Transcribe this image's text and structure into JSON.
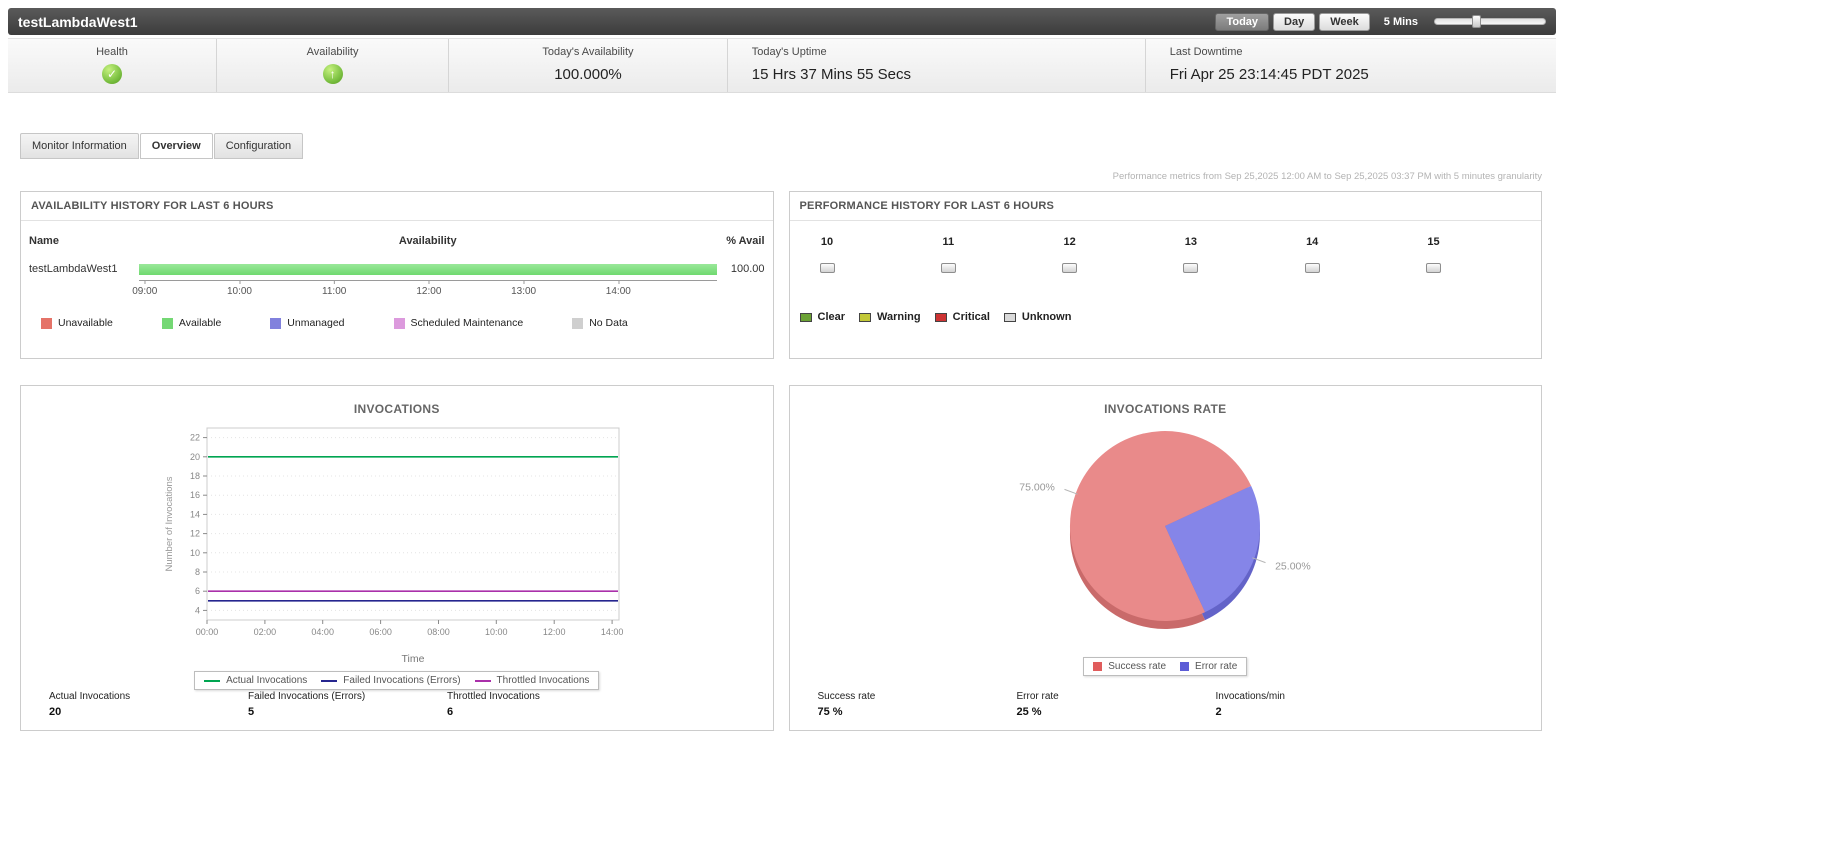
{
  "header": {
    "title": "testLambdaWest1",
    "period_buttons": [
      {
        "label": "Today",
        "active": true
      },
      {
        "label": "Day",
        "active": false
      },
      {
        "label": "Week",
        "active": false
      }
    ],
    "granularity_label": "5 Mins"
  },
  "status_bar": {
    "items": [
      {
        "label": "Health",
        "icon": "health-status-ok",
        "glyph": "✓"
      },
      {
        "label": "Availability",
        "icon": "availability-status-up",
        "glyph": "↑"
      },
      {
        "label": "Today's Availability",
        "value": "100.000%"
      },
      {
        "label": "Today's Uptime",
        "value": "15 Hrs 37 Mins 55 Secs"
      },
      {
        "label": "Last Downtime",
        "value": "Fri Apr 25 23:14:45 PDT 2025"
      }
    ]
  },
  "tabs": [
    {
      "label": "Monitor Information",
      "active": false
    },
    {
      "label": "Overview",
      "active": true
    },
    {
      "label": "Configuration",
      "active": false
    }
  ],
  "metrics_note": "Performance metrics from Sep 25,2025 12:00 AM to Sep 25,2025 03:37 PM with 5 minutes granularity",
  "availability_panel": {
    "title": "AVAILABILITY HISTORY FOR LAST 6 HOURS",
    "columns": {
      "name": "Name",
      "availability": "Availability",
      "avail_pct": "% Avail"
    },
    "row": {
      "name": "testLambdaWest1",
      "avail_pct": "100.00",
      "availability_percent": 100
    },
    "x_ticks": [
      "09:00",
      "10:00",
      "11:00",
      "12:00",
      "13:00",
      "14:00"
    ],
    "bar_color": "#6fd96f",
    "legend": [
      {
        "label": "Unavailable",
        "color": "#e57368"
      },
      {
        "label": "Available",
        "color": "#74d874"
      },
      {
        "label": "Unmanaged",
        "color": "#8181dd"
      },
      {
        "label": "Scheduled Maintenance",
        "color": "#dc9add"
      },
      {
        "label": "No Data",
        "color": "#cfcfcf"
      }
    ]
  },
  "performance_panel": {
    "title": "PERFORMANCE HISTORY FOR LAST 6 HOURS",
    "hours": [
      "10",
      "11",
      "12",
      "13",
      "14",
      "15"
    ],
    "legend": [
      {
        "label": "Clear",
        "color": "#6ba235"
      },
      {
        "label": "Warning",
        "color": "#c2c838"
      },
      {
        "label": "Critical",
        "color": "#cd3333"
      },
      {
        "label": "Unknown",
        "color": "#d9d9d9"
      }
    ]
  },
  "invocations_panel": {
    "title": "INVOCATIONS",
    "stats": [
      {
        "label": "Actual Invocations",
        "value": "20"
      },
      {
        "label": "Failed Invocations (Errors)",
        "value": "5"
      },
      {
        "label": "Throttled Invocations",
        "value": "6"
      }
    ]
  },
  "invocations_rate_panel": {
    "title": "INVOCATIONS RATE",
    "stats": [
      {
        "label": "Success rate",
        "value": "75 %"
      },
      {
        "label": "Error rate",
        "value": "25 %"
      },
      {
        "label": "Invocations/min",
        "value": "2"
      }
    ]
  },
  "chart_data": [
    {
      "type": "bar",
      "title": "Availability History for Last 6 Hours",
      "categories": [
        "testLambdaWest1"
      ],
      "series": [
        {
          "name": "Available",
          "values": [
            100
          ]
        }
      ],
      "x_ticks": [
        "09:00",
        "10:00",
        "11:00",
        "12:00",
        "13:00",
        "14:00"
      ]
    },
    {
      "type": "line",
      "title": "INVOCATIONS",
      "xlabel": "Time",
      "ylabel": "Number of Invocations",
      "ylim": [
        4,
        22
      ],
      "y_ticks": [
        4,
        6,
        8,
        10,
        12,
        14,
        16,
        18,
        20,
        22
      ],
      "x_ticks": [
        "00:00",
        "02:00",
        "04:00",
        "06:00",
        "08:00",
        "10:00",
        "12:00",
        "14:00"
      ],
      "series": [
        {
          "name": "Actual Invocations",
          "color": "#00a551",
          "value": 20
        },
        {
          "name": "Failed Invocations (Errors)",
          "color": "#26268f",
          "value": 5
        },
        {
          "name": "Throttled Invocations",
          "color": "#aa30aa",
          "value": 6
        }
      ],
      "grid": true,
      "legend_position": "bottom"
    },
    {
      "type": "pie",
      "title": "INVOCATIONS RATE",
      "slices": [
        {
          "label": "Success rate",
          "value": 75,
          "display": "75.00%",
          "color": "#e98a8a",
          "dark": "#c96a6a",
          "legend_color": "#e05c5c"
        },
        {
          "label": "Error rate",
          "value": 25,
          "display": "25.00%",
          "color": "#8585e8",
          "dark": "#6363c8",
          "legend_color": "#5c5cd6"
        }
      ],
      "legend_position": "bottom"
    }
  ]
}
